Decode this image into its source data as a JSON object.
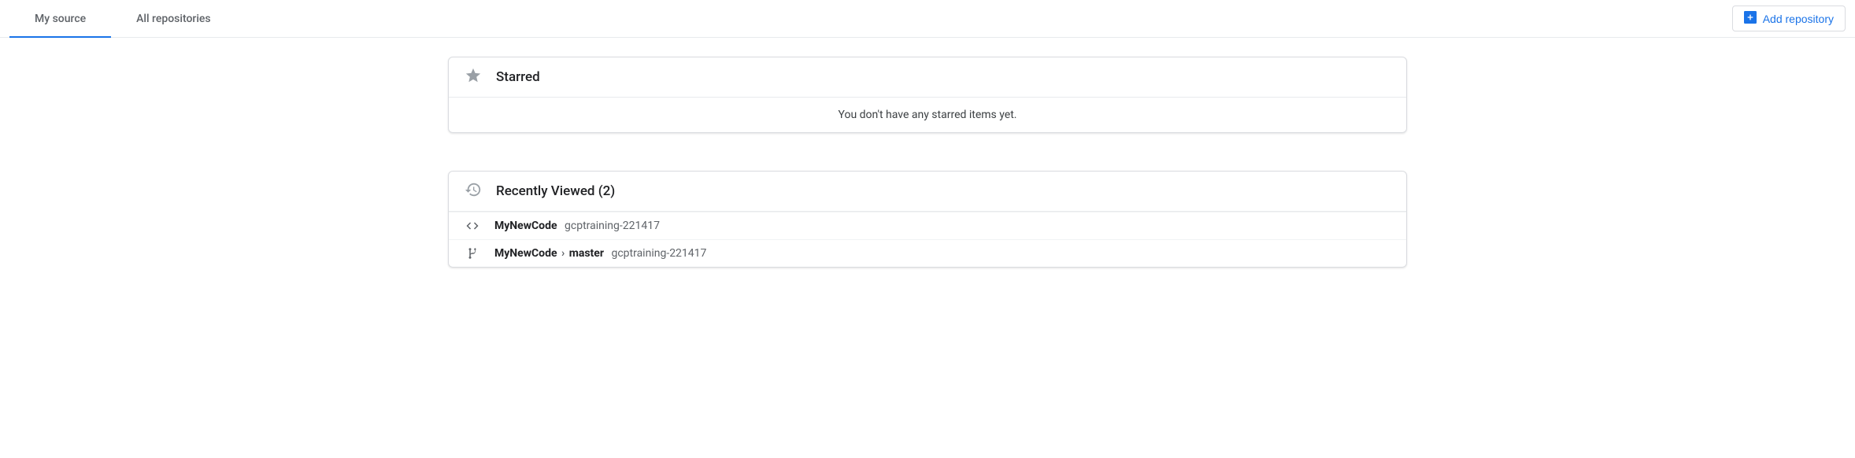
{
  "tabs": {
    "my_source": "My source",
    "all_repositories": "All repositories"
  },
  "add_repo_label": "Add repository",
  "starred": {
    "title": "Starred",
    "empty_text": "You don't have any starred items yet."
  },
  "recently_viewed": {
    "title": "Recently Viewed (2)",
    "items": [
      {
        "name": "MyNewCode",
        "project": "gcptraining-221417",
        "type": "repo"
      },
      {
        "name": "MyNewCode",
        "branch": "master",
        "project": "gcptraining-221417",
        "type": "branch"
      }
    ]
  }
}
